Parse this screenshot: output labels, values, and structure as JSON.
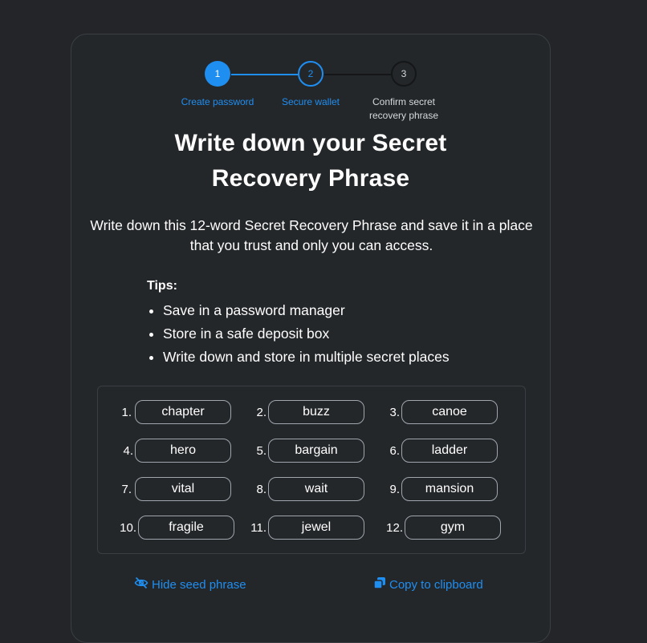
{
  "stepper": {
    "steps": [
      {
        "number": "1",
        "label": "Create password"
      },
      {
        "number": "2",
        "label": "Secure wallet"
      },
      {
        "number": "3",
        "label_line1": "Confirm secret",
        "label_line2": "recovery phrase"
      }
    ]
  },
  "title": {
    "line1": "Write down your Secret",
    "line2": "Recovery Phrase"
  },
  "description": "Write down this 12-word Secret Recovery Phrase and save it in a place that you trust and only you can access.",
  "tips": {
    "title": "Tips:",
    "items": [
      "Save in a password manager",
      "Store in a safe deposit box",
      "Write down and store in multiple secret places"
    ]
  },
  "seed_words": [
    {
      "index": "1.",
      "word": "chapter"
    },
    {
      "index": "2.",
      "word": "buzz"
    },
    {
      "index": "3.",
      "word": "canoe"
    },
    {
      "index": "4.",
      "word": "hero"
    },
    {
      "index": "5.",
      "word": "bargain"
    },
    {
      "index": "6.",
      "word": "ladder"
    },
    {
      "index": "7.",
      "word": "vital"
    },
    {
      "index": "8.",
      "word": "wait"
    },
    {
      "index": "9.",
      "word": "mansion"
    },
    {
      "index": "10.",
      "word": "fragile"
    },
    {
      "index": "11.",
      "word": "jewel"
    },
    {
      "index": "12.",
      "word": "gym"
    }
  ],
  "actions": {
    "hide_label": "Hide seed phrase",
    "hide_icon": "eye-slash-icon",
    "copy_label": "Copy to clipboard",
    "copy_icon": "copy-icon"
  },
  "colors": {
    "accent": "#1f8ef1",
    "background": "#232528",
    "card": "#24272a",
    "border": "#3b3f44"
  }
}
